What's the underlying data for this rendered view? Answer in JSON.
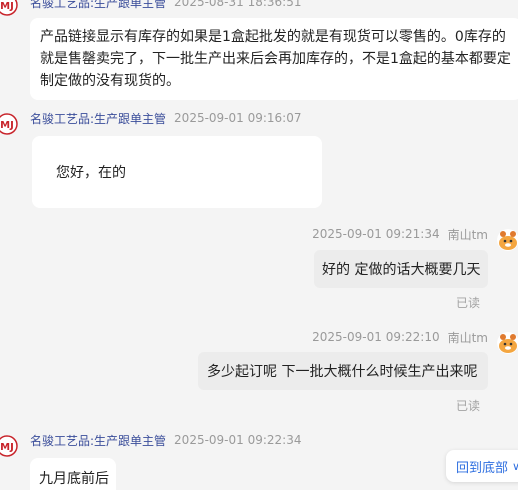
{
  "messages": [
    {
      "side": "in",
      "sender": "名骏工艺品:生产跟单主管",
      "time": "2025-08-31 18:36:51",
      "text": "产品链接显示有库存的如果是1盒起批发的就是有现货可以零售的。0库存的就是售罄卖完了，下一批生产出来后会再加库存的，不是1盒起的基本都要定制定做的没有现货的。"
    },
    {
      "side": "in",
      "sender": "名骏工艺品:生产跟单主管",
      "time": "2025-09-01 09:16:07",
      "text": "您好，在的"
    },
    {
      "side": "out",
      "sender": "南山tm",
      "time": "2025-09-01 09:21:34",
      "text": "好的 定做的话大概要几天",
      "status": "已读"
    },
    {
      "side": "out",
      "sender": "南山tm",
      "time": "2025-09-01 09:22:10",
      "text": "多少起订呢  下一批大概什么时候生产出来呢",
      "status": "已读"
    },
    {
      "side": "in",
      "sender": "名骏工艺品:生产跟单主管",
      "time": "2025-09-01 09:22:34",
      "text": "九月底前后"
    }
  ],
  "avatars": {
    "shop_logo_text": "MJ",
    "shop_color": "#c8242b"
  },
  "controls": {
    "jump_to_bottom": "回到底部",
    "jump_chevron": "∨"
  }
}
